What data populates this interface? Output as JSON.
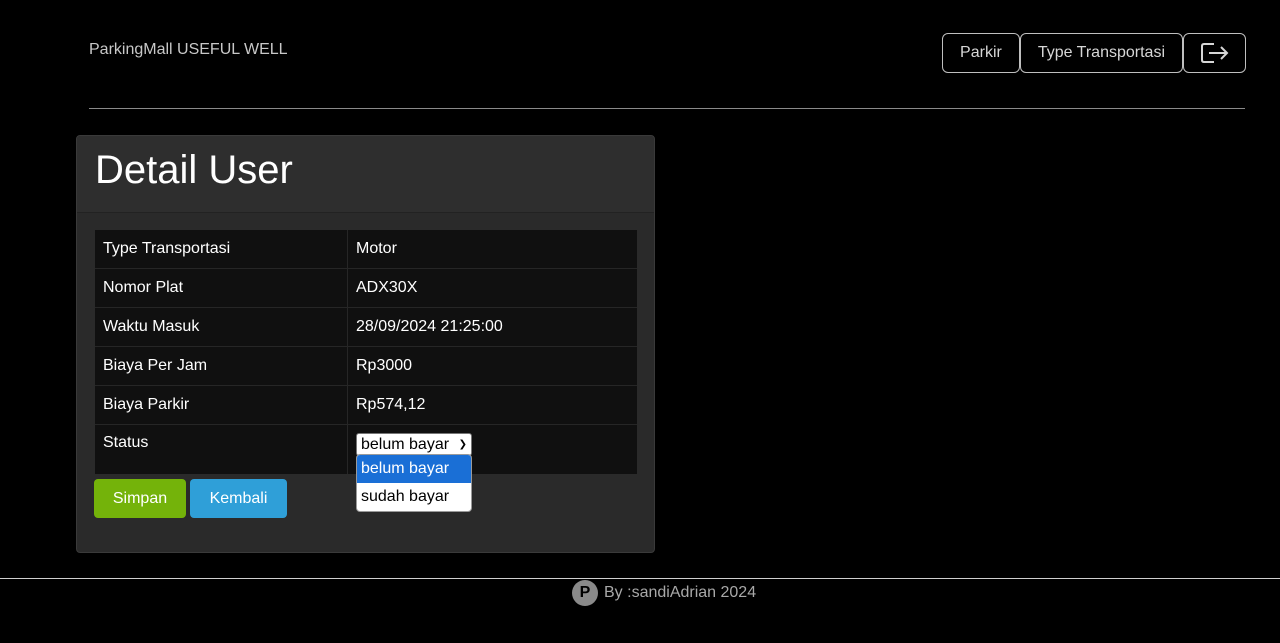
{
  "header": {
    "brand": "ParkingMall USEFUL WELL",
    "nav": [
      {
        "label": "Parkir"
      },
      {
        "label": "Type Transportasi"
      }
    ],
    "logout_icon": "logout-icon"
  },
  "card": {
    "title": "Detail User",
    "rows": [
      {
        "key": "Type Transportasi",
        "value": "Motor"
      },
      {
        "key": "Nomor Plat",
        "value": "ADX30X"
      },
      {
        "key": "Waktu Masuk",
        "value": "28/09/2024 21:25:00"
      },
      {
        "key": "Biaya Per Jam",
        "value": "Rp3000"
      },
      {
        "key": "Biaya Parkir",
        "value": "Rp574,12"
      }
    ],
    "status": {
      "key": "Status",
      "selected": "belum bayar",
      "options": [
        "belum bayar",
        "sudah bayar"
      ]
    },
    "buttons": {
      "save": "Simpan",
      "back": "Kembali"
    }
  },
  "footer": {
    "icon_letter": "P",
    "text": "By :sandiAdrian 2024"
  },
  "colors": {
    "background": "#000000",
    "card": "#2a2a2a",
    "save": "#74b30a",
    "back": "#2f9fd8",
    "dropdown_selected": "#1a6fd6"
  }
}
